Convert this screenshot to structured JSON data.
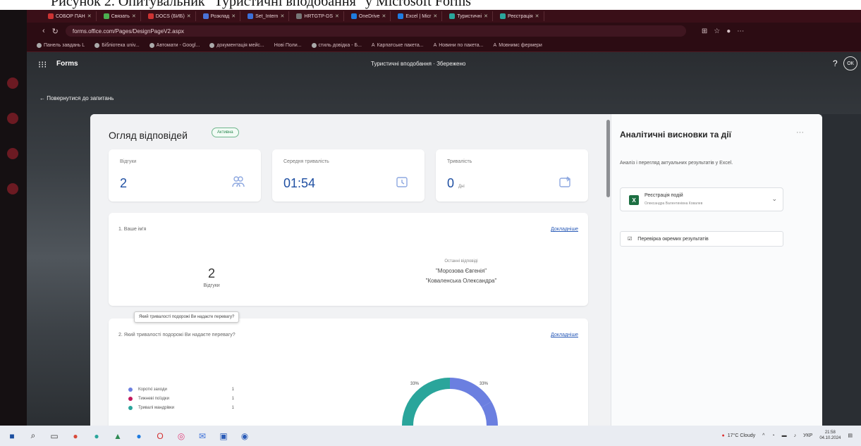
{
  "caption": "Рисунок 2. Опитувальник \"Туристичні вподобання\" у Microsoft Forms",
  "browser": {
    "tabs": [
      "СОБОР ПАН",
      "Связать",
      "DOCS (БИБ)",
      "Розклад",
      "Set_Intern",
      "HRTGTP-DS",
      "OneDrive",
      "Excel | Micr",
      "Туристичні",
      "Реєстрація"
    ],
    "url": "forms.office.com/Pages/DesignPageV2.aspx",
    "bookmarks": [
      "Панель завдань L",
      "Бібліотека univ...",
      "Автомати - Googl...",
      "документація мейс...",
      "Нові Поли...",
      "стиль довідка - Б...",
      "Карпатське пакета...",
      "Новини по пакета...",
      "Мовнимс фермери"
    ]
  },
  "app": {
    "name": "Forms",
    "form_title": "Туристичні вподобання · Збережено",
    "help": "?",
    "user_initials": "ОК",
    "back_link": "Повернутися до запитань"
  },
  "overview": {
    "title": "Огляд відповідей",
    "status": "Активна",
    "stats": [
      {
        "label": "Відгуки",
        "value": "2",
        "unit": "",
        "icon": "people-icon"
      },
      {
        "label": "Середня тривалість",
        "value": "01:54",
        "unit": "",
        "icon": "alarm-clock-icon"
      },
      {
        "label": "Тривалість",
        "value": "0",
        "unit": "Дні",
        "icon": "calendar-arrow-icon"
      }
    ]
  },
  "questions": [
    {
      "title": "1. Ваше ім'я",
      "details_link": "Докладніше",
      "count": "2",
      "count_label": "Відгуки",
      "latest_header": "Останні відповіді",
      "latest": [
        "\"Морозова Євгенія\"",
        "\"Коваленська Олександра\""
      ]
    },
    {
      "title": "2. Який тривалості подорожі Ви надаєте перевагу?",
      "details_link": "Докладніше",
      "tooltip": "Який тривалості подорожі Ви надаєте перевагу?",
      "legend": [
        {
          "label": "Короткі заходи",
          "count": "1",
          "color": "#6b7fe0"
        },
        {
          "label": "Тижневі поїздки",
          "count": "1",
          "color": "#c3185c"
        },
        {
          "label": "Тривалі мандрівки",
          "count": "1",
          "color": "#2aa59b"
        }
      ],
      "pct_left": "33%",
      "pct_right": "33%"
    }
  ],
  "insights": {
    "title": "Аналітичні висновки та дії",
    "more": "···",
    "desc": "Аналіз і перегляд актуальних результатів у Excel.",
    "excel_name": "Реєстрація подій",
    "excel_owner": "Олександра Валентинівна Ковалев",
    "check_label": "Перевірка окремих результатів"
  },
  "taskbar": {
    "weather": "17°C Cloudy",
    "time": "21:58",
    "date": "04.10.2024",
    "lang": "УКР"
  }
}
